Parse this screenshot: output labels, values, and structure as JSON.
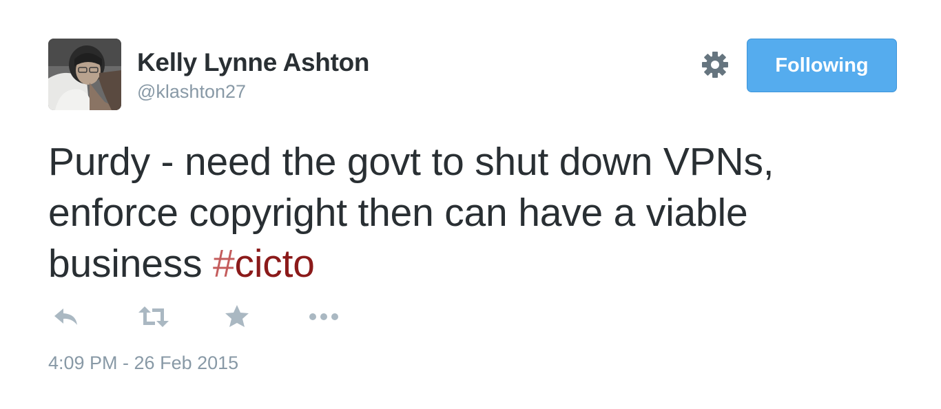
{
  "user": {
    "display_name": "Kelly Lynne Ashton",
    "handle": "@klashton27"
  },
  "header": {
    "settings_icon": "gear-icon",
    "follow_button_label": "Following",
    "follow_button_color": "#55acee"
  },
  "tweet": {
    "text_before_hashtag": "Purdy - need the govt to shut down VPNs, enforce copyright then can have a viable business ",
    "hashtag_symbol": "#",
    "hashtag_text": "cicto",
    "hashtag_color": "#8b1a1a"
  },
  "actions": {
    "icons": [
      "reply-icon",
      "retweet-icon",
      "favorite-icon",
      "more-icon"
    ],
    "icon_color": "#aab8c2"
  },
  "timestamp": "4:09 PM - 26 Feb 2015"
}
